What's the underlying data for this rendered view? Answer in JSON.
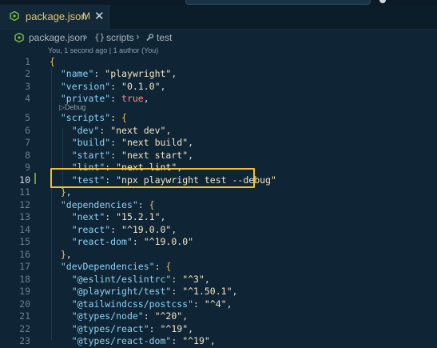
{
  "tab": {
    "filename": "package.json",
    "status": "M",
    "close": "✕"
  },
  "breadcrumb": {
    "file": "package.json",
    "section": "scripts",
    "item": "test",
    "braces": "{}",
    "sep": "›"
  },
  "codelens": {
    "blame": "You, 1 second ago | 1 author (You)",
    "debug": "▷Debug"
  },
  "active_line": 10,
  "lines": [
    {
      "n": "1",
      "tokens": [
        {
          "t": "{",
          "c": "b"
        }
      ]
    },
    {
      "n": "2",
      "tokens": [
        {
          "t": "  "
        },
        {
          "t": "\"name\"",
          "c": "k"
        },
        {
          "t": ": ",
          "c": "p"
        },
        {
          "t": "\"playwright\"",
          "c": "s"
        },
        {
          "t": ",",
          "c": "p"
        }
      ]
    },
    {
      "n": "3",
      "tokens": [
        {
          "t": "  "
        },
        {
          "t": "\"version\"",
          "c": "k"
        },
        {
          "t": ": ",
          "c": "p"
        },
        {
          "t": "\"0.1.0\"",
          "c": "s"
        },
        {
          "t": ",",
          "c": "p"
        }
      ]
    },
    {
      "n": "4",
      "tokens": [
        {
          "t": "  "
        },
        {
          "t": "\"private\"",
          "c": "k"
        },
        {
          "t": ": ",
          "c": "p"
        },
        {
          "t": "true",
          "c": "bool"
        },
        {
          "t": ",",
          "c": "p"
        }
      ]
    },
    {
      "n": "5",
      "tokens": [
        {
          "t": "  "
        },
        {
          "t": "\"scripts\"",
          "c": "k"
        },
        {
          "t": ": ",
          "c": "p"
        },
        {
          "t": "{",
          "c": "b"
        }
      ]
    },
    {
      "n": "6",
      "tokens": [
        {
          "t": "    "
        },
        {
          "t": "\"dev\"",
          "c": "k"
        },
        {
          "t": ": ",
          "c": "p"
        },
        {
          "t": "\"next dev\"",
          "c": "s"
        },
        {
          "t": ",",
          "c": "p"
        }
      ]
    },
    {
      "n": "7",
      "tokens": [
        {
          "t": "    "
        },
        {
          "t": "\"build\"",
          "c": "k"
        },
        {
          "t": ": ",
          "c": "p"
        },
        {
          "t": "\"next build\"",
          "c": "s"
        },
        {
          "t": ",",
          "c": "p"
        }
      ]
    },
    {
      "n": "8",
      "tokens": [
        {
          "t": "    "
        },
        {
          "t": "\"start\"",
          "c": "k"
        },
        {
          "t": ": ",
          "c": "p"
        },
        {
          "t": "\"next start\"",
          "c": "s"
        },
        {
          "t": ",",
          "c": "p"
        }
      ]
    },
    {
      "n": "9",
      "tokens": [
        {
          "t": "    "
        },
        {
          "t": "\"lint\"",
          "c": "k"
        },
        {
          "t": ": ",
          "c": "p"
        },
        {
          "t": "\"next lint\"",
          "c": "s"
        },
        {
          "t": ",",
          "c": "p"
        }
      ]
    },
    {
      "n": "10",
      "tokens": [
        {
          "t": "    "
        },
        {
          "t": "\"test\"",
          "c": "k"
        },
        {
          "t": ": ",
          "c": "p"
        },
        {
          "t": "\"npx playwright test --debug\"",
          "c": "s"
        }
      ]
    },
    {
      "n": "11",
      "tokens": [
        {
          "t": "  "
        },
        {
          "t": "}",
          "c": "b"
        },
        {
          "t": ",",
          "c": "p"
        }
      ]
    },
    {
      "n": "12",
      "tokens": [
        {
          "t": "  "
        },
        {
          "t": "\"dependencies\"",
          "c": "k"
        },
        {
          "t": ": ",
          "c": "p"
        },
        {
          "t": "{",
          "c": "b"
        }
      ]
    },
    {
      "n": "13",
      "tokens": [
        {
          "t": "    "
        },
        {
          "t": "\"next\"",
          "c": "k"
        },
        {
          "t": ": ",
          "c": "p"
        },
        {
          "t": "\"15.2.1\"",
          "c": "s"
        },
        {
          "t": ",",
          "c": "p"
        }
      ]
    },
    {
      "n": "14",
      "tokens": [
        {
          "t": "    "
        },
        {
          "t": "\"react\"",
          "c": "k"
        },
        {
          "t": ": ",
          "c": "p"
        },
        {
          "t": "\"^19.0.0\"",
          "c": "s"
        },
        {
          "t": ",",
          "c": "p"
        }
      ]
    },
    {
      "n": "15",
      "tokens": [
        {
          "t": "    "
        },
        {
          "t": "\"react-dom\"",
          "c": "k"
        },
        {
          "t": ": ",
          "c": "p"
        },
        {
          "t": "\"^19.0.0\"",
          "c": "s"
        }
      ]
    },
    {
      "n": "16",
      "tokens": [
        {
          "t": "  "
        },
        {
          "t": "}",
          "c": "b"
        },
        {
          "t": ",",
          "c": "p"
        }
      ]
    },
    {
      "n": "17",
      "tokens": [
        {
          "t": "  "
        },
        {
          "t": "\"devDependencies\"",
          "c": "k"
        },
        {
          "t": ": ",
          "c": "p"
        },
        {
          "t": "{",
          "c": "b"
        }
      ]
    },
    {
      "n": "18",
      "tokens": [
        {
          "t": "    "
        },
        {
          "t": "\"@eslint/eslintrc\"",
          "c": "k"
        },
        {
          "t": ": ",
          "c": "p"
        },
        {
          "t": "\"^3\"",
          "c": "s"
        },
        {
          "t": ",",
          "c": "p"
        }
      ]
    },
    {
      "n": "19",
      "tokens": [
        {
          "t": "    "
        },
        {
          "t": "\"@playwright/test\"",
          "c": "k"
        },
        {
          "t": ": ",
          "c": "p"
        },
        {
          "t": "\"^1.50.1\"",
          "c": "s"
        },
        {
          "t": ",",
          "c": "p"
        }
      ]
    },
    {
      "n": "20",
      "tokens": [
        {
          "t": "    "
        },
        {
          "t": "\"@tailwindcss/postcss\"",
          "c": "k"
        },
        {
          "t": ": ",
          "c": "p"
        },
        {
          "t": "\"^4\"",
          "c": "s"
        },
        {
          "t": ",",
          "c": "p"
        }
      ]
    },
    {
      "n": "21",
      "tokens": [
        {
          "t": "    "
        },
        {
          "t": "\"@types/node\"",
          "c": "k"
        },
        {
          "t": ": ",
          "c": "p"
        },
        {
          "t": "\"^20\"",
          "c": "s"
        },
        {
          "t": ",",
          "c": "p"
        }
      ]
    },
    {
      "n": "22",
      "tokens": [
        {
          "t": "    "
        },
        {
          "t": "\"@types/react\"",
          "c": "k"
        },
        {
          "t": ": ",
          "c": "p"
        },
        {
          "t": "\"^19\"",
          "c": "s"
        },
        {
          "t": ",",
          "c": "p"
        }
      ]
    },
    {
      "n": "23",
      "tokens": [
        {
          "t": "    "
        },
        {
          "t": "\"@types/react-dom\"",
          "c": "k"
        },
        {
          "t": ": ",
          "c": "p"
        },
        {
          "t": "\"^19\"",
          "c": "s"
        },
        {
          "t": ",",
          "c": "p"
        }
      ]
    }
  ],
  "colors": {
    "key": "#8cd3f5",
    "string": "#f0e6c8",
    "brace": "#eec25a",
    "bool": "#ff8a8a",
    "highlight": "#f2c12e",
    "tab_text": "#e7c36c"
  }
}
